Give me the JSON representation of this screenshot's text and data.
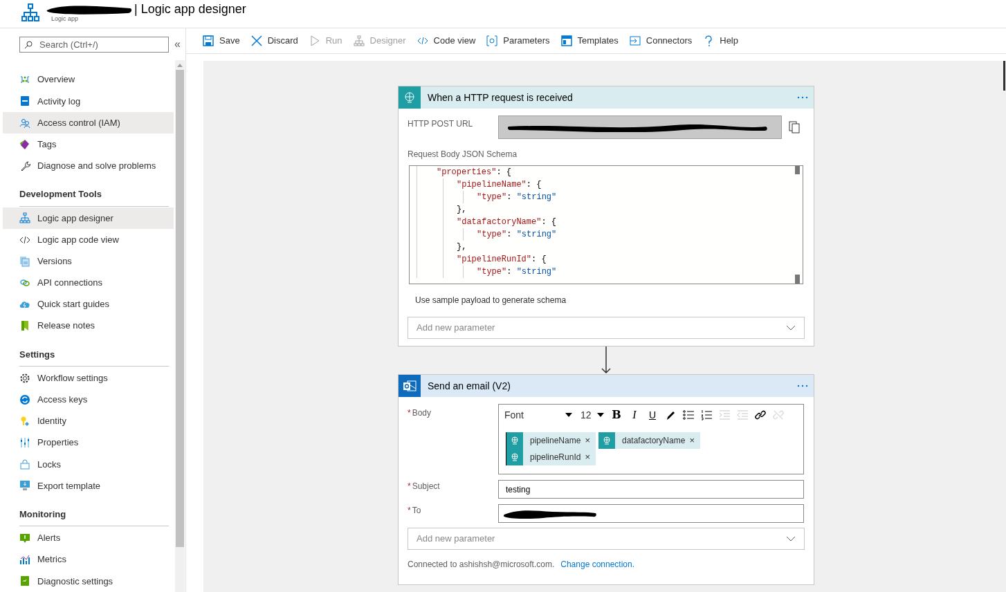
{
  "header": {
    "title": "| Logic app designer",
    "subtitle": "Logic app"
  },
  "sidebar": {
    "search": {
      "placeholder": "Search (Ctrl+/)"
    },
    "collapse": "«",
    "sections": [
      {
        "items": [
          {
            "label": "Overview",
            "highlighted": false
          },
          {
            "label": "Activity log",
            "highlighted": false
          },
          {
            "label": "Access control (IAM)",
            "highlighted": true
          },
          {
            "label": "Tags",
            "highlighted": false
          },
          {
            "label": "Diagnose and solve problems",
            "highlighted": false
          }
        ]
      },
      {
        "title": "Development Tools",
        "items": [
          {
            "label": "Logic app designer",
            "highlighted": true
          },
          {
            "label": "Logic app code view",
            "highlighted": false
          },
          {
            "label": "Versions",
            "highlighted": false
          },
          {
            "label": "API connections",
            "highlighted": false
          },
          {
            "label": "Quick start guides",
            "highlighted": false
          },
          {
            "label": "Release notes",
            "highlighted": false
          }
        ]
      },
      {
        "title": "Settings",
        "items": [
          {
            "label": "Workflow settings",
            "highlighted": false
          },
          {
            "label": "Access keys",
            "highlighted": false
          },
          {
            "label": "Identity",
            "highlighted": false
          },
          {
            "label": "Properties",
            "highlighted": false
          },
          {
            "label": "Locks",
            "highlighted": false
          },
          {
            "label": "Export template",
            "highlighted": false
          }
        ]
      },
      {
        "title": "Monitoring",
        "items": [
          {
            "label": "Alerts",
            "highlighted": false
          },
          {
            "label": "Metrics",
            "highlighted": false
          },
          {
            "label": "Diagnostic settings",
            "highlighted": false
          }
        ]
      }
    ]
  },
  "toolbar": [
    {
      "label": "Save",
      "disabled": false
    },
    {
      "label": "Discard",
      "disabled": false
    },
    {
      "label": "Run",
      "disabled": true
    },
    {
      "label": "Designer",
      "disabled": true
    },
    {
      "label": "Code view",
      "disabled": false
    },
    {
      "label": "Parameters",
      "disabled": false
    },
    {
      "label": "Templates",
      "disabled": false
    },
    {
      "label": "Connectors",
      "disabled": false
    },
    {
      "label": "Help",
      "disabled": false
    }
  ],
  "trigger": {
    "title": "When a HTTP request is received",
    "url_label": "HTTP POST URL",
    "schema_label": "Request Body JSON Schema",
    "schema_lines": [
      {
        "tokens": [
          {
            "kind": "key",
            "text": "\"properties\""
          },
          {
            "kind": "punct",
            "text": ": {"
          }
        ],
        "children": [
          {
            "tokens": [
              {
                "kind": "key",
                "text": "\"pipelineName\""
              },
              {
                "kind": "punct",
                "text": ": {"
              }
            ],
            "children": [
              {
                "tokens": [
                  {
                    "kind": "key",
                    "text": "\"type\""
                  },
                  {
                    "kind": "punct",
                    "text": ": "
                  },
                  {
                    "kind": "string",
                    "text": "\"string\""
                  }
                ]
              }
            ]
          },
          {
            "tokens": [
              {
                "kind": "punct",
                "text": "},"
              }
            ]
          },
          {
            "tokens": [
              {
                "kind": "key",
                "text": "\"datafactoryName\""
              },
              {
                "kind": "punct",
                "text": ": {"
              }
            ],
            "children": [
              {
                "tokens": [
                  {
                    "kind": "key",
                    "text": "\"type\""
                  },
                  {
                    "kind": "punct",
                    "text": ": "
                  },
                  {
                    "kind": "string",
                    "text": "\"string\""
                  }
                ]
              }
            ]
          },
          {
            "tokens": [
              {
                "kind": "punct",
                "text": "},"
              }
            ]
          },
          {
            "tokens": [
              {
                "kind": "key",
                "text": "\"pipelineRunId\""
              },
              {
                "kind": "punct",
                "text": ": {"
              }
            ],
            "children": [
              {
                "tokens": [
                  {
                    "kind": "key",
                    "text": "\"type\""
                  },
                  {
                    "kind": "punct",
                    "text": ": "
                  },
                  {
                    "kind": "string",
                    "text": "\"string\""
                  }
                ]
              }
            ]
          }
        ]
      }
    ],
    "sample_link": "Use sample payload to generate schema",
    "add_parameter": {
      "placeholder": "Add new parameter"
    }
  },
  "action": {
    "title": "Send an email (V2)",
    "body": {
      "label": "Body",
      "required_mark": "*",
      "font": "Font",
      "size": "12",
      "tools": [
        {
          "kind": "bold",
          "label": "B",
          "disabled": false
        },
        {
          "kind": "italic",
          "label": "I",
          "disabled": false
        },
        {
          "kind": "underline",
          "label": "U",
          "disabled": false
        },
        {
          "kind": "color",
          "disabled": false
        },
        {
          "kind": "bullets",
          "disabled": false
        },
        {
          "kind": "numbers",
          "disabled": false
        },
        {
          "kind": "indent",
          "disabled": true
        },
        {
          "kind": "outdent",
          "disabled": true
        },
        {
          "kind": "link",
          "disabled": false
        },
        {
          "kind": "unlink",
          "disabled": true
        }
      ],
      "tokens": [
        {
          "text": "pipelineName",
          "remove": "×"
        },
        {
          "text": "datafactoryName",
          "remove": "×"
        },
        {
          "text": "pipelineRunId",
          "remove": "×"
        }
      ]
    },
    "subject": {
      "label": "Subject",
      "required_mark": "*",
      "value": "testing"
    },
    "to": {
      "label": "To",
      "required_mark": "*"
    },
    "add_parameter": {
      "placeholder": "Add new parameter"
    },
    "connection": {
      "text": "Connected to ashishsh@microsoft.com.",
      "link": "Change connection."
    }
  }
}
